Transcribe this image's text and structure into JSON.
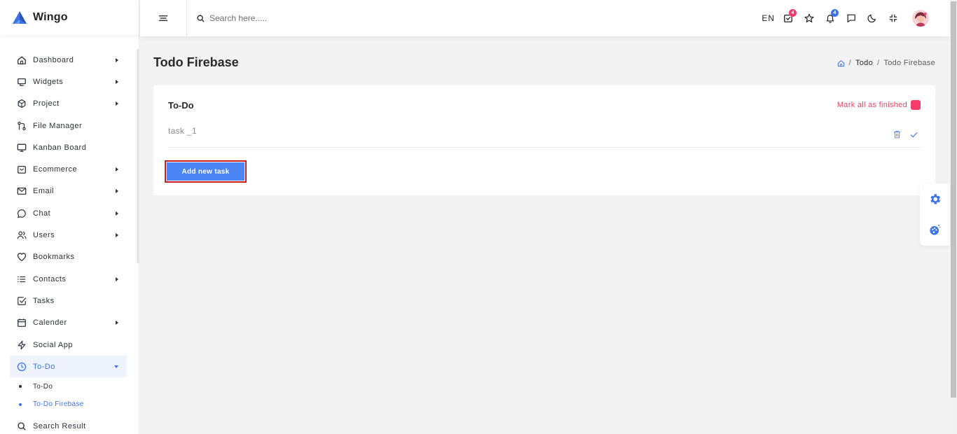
{
  "brand": {
    "name": "Wingo"
  },
  "search": {
    "placeholder": "Search here....."
  },
  "header": {
    "language": "EN",
    "cart_badge": "4",
    "notification_badge": "4",
    "colors": {
      "cart_badge": "#f53b6a",
      "notification_badge": "#3c74e7"
    }
  },
  "sidebar": {
    "items": [
      {
        "label": "Dashboard",
        "icon": "home-icon",
        "has_caret": true
      },
      {
        "label": "Widgets",
        "icon": "widgets-icon",
        "has_caret": true
      },
      {
        "label": "Project",
        "icon": "box-icon",
        "has_caret": true
      },
      {
        "label": "File Manager",
        "icon": "git-pull-icon",
        "has_caret": false
      },
      {
        "label": "Kanban Board",
        "icon": "monitor-icon",
        "has_caret": false
      },
      {
        "label": "Ecommerce",
        "icon": "shopping-bag-icon",
        "has_caret": true
      },
      {
        "label": "Email",
        "icon": "mail-icon",
        "has_caret": true
      },
      {
        "label": "Chat",
        "icon": "chat-icon",
        "has_caret": true
      },
      {
        "label": "Users",
        "icon": "users-icon",
        "has_caret": true
      },
      {
        "label": "Bookmarks",
        "icon": "heart-icon",
        "has_caret": false
      },
      {
        "label": "Contacts",
        "icon": "list-icon",
        "has_caret": true
      },
      {
        "label": "Tasks",
        "icon": "check-square-icon",
        "has_caret": false
      },
      {
        "label": "Calender",
        "icon": "calendar-icon",
        "has_caret": true
      },
      {
        "label": "Social App",
        "icon": "zap-icon",
        "has_caret": false
      },
      {
        "label": "To-Do",
        "icon": "clock-icon",
        "has_caret": true,
        "active": true
      }
    ],
    "submenu": [
      {
        "label": "To-Do"
      },
      {
        "label": "To-Do Firebase",
        "current": true
      }
    ],
    "last_item": {
      "label": "Search Result",
      "icon": "search-icon"
    }
  },
  "page": {
    "title": "Todo Firebase",
    "breadcrumb": [
      "Todo",
      "Todo Firebase"
    ]
  },
  "todo": {
    "card_title": "To-Do",
    "mark_all_label": "Mark all as finished",
    "tasks": [
      {
        "text": "task _1"
      }
    ],
    "add_button_label": "Add new task"
  },
  "colors": {
    "accent": "#3c74e7",
    "danger": "#f53b6a",
    "button": "#4b84f3"
  }
}
